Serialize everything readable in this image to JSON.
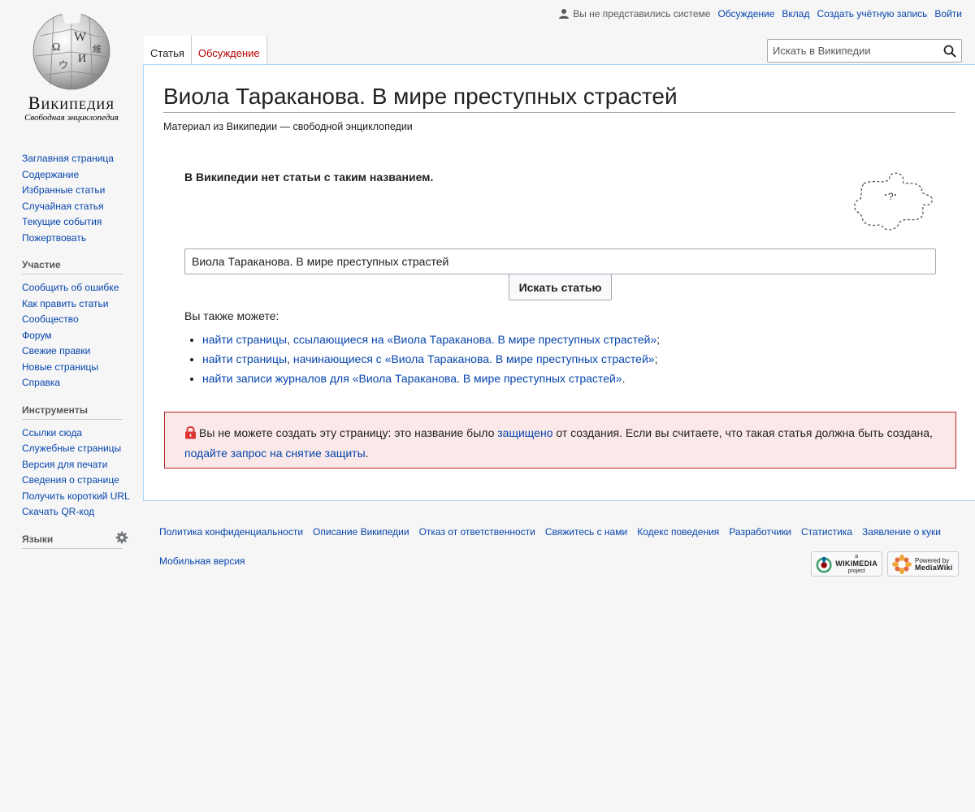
{
  "personal": {
    "anon_text": "Вы не представились системе",
    "links": [
      "Обсуждение",
      "Вклад",
      "Создать учётную запись",
      "Войти"
    ]
  },
  "logo": {
    "wordmark": "Википедия",
    "tagline": "Свободная энциклопедия"
  },
  "tabs": [
    {
      "label": "Статья",
      "selected": true
    },
    {
      "label": "Обсуждение",
      "selected": false
    }
  ],
  "search": {
    "placeholder": "Искать в Википедии"
  },
  "sidebar": {
    "nav": [
      "Заглавная страница",
      "Содержание",
      "Избранные статьи",
      "Случайная статья",
      "Текущие события",
      "Пожертвовать"
    ],
    "participate": {
      "heading": "Участие",
      "items": [
        "Сообщить об ошибке",
        "Как править статьи",
        "Сообщество",
        "Форум",
        "Свежие правки",
        "Новые страницы",
        "Справка"
      ]
    },
    "tools": {
      "heading": "Инструменты",
      "items": [
        "Ссылки сюда",
        "Служебные страницы",
        "Версия для печати",
        "Сведения о странице",
        "Получить короткий URL",
        "Скачать QR-код"
      ]
    },
    "languages": {
      "heading": "Языки"
    }
  },
  "content": {
    "title": "Виола Тараканова. В мире преступных страстей",
    "site_sub": "Материал из Википедии — свободной энциклопедии",
    "no_article": "В Википедии нет статьи с таким названием.",
    "search_value": "Виола Тараканова. В мире преступных страстей",
    "search_button": "Искать статью",
    "also_can": "Вы также можете:",
    "also_list": [
      {
        "link1": "найти страницы",
        "sep": ", ",
        "link2": "ссылающиеся на «Виола Тараканова. В мире преступных страстей»",
        "end": ";"
      },
      {
        "link1": "найти страницы",
        "sep": ", ",
        "link2": "начинающиеся с «Виола Тараканова. В мире преступных страстей»",
        "end": ";"
      },
      {
        "link1": "найти записи журналов для «Виола Тараканова",
        "sep": ". ",
        "link2": "В мире преступных страстей»",
        "end": "."
      }
    ],
    "protect": {
      "text1": "Вы не можете создать эту страницу: это название было ",
      "link1": "защищено",
      "text2": " от создания. Если вы считаете, что такая статья должна быть создана, ",
      "link2": "подайте запрос на снятие защиты",
      "text3": "."
    }
  },
  "footer": {
    "links": [
      "Политика конфиденциальности",
      "Описание Википедии",
      "Отказ от ответственности",
      "Свяжитесь с нами",
      "Кодекс поведения",
      "Разработчики",
      "Статистика",
      "Заявление о куки"
    ],
    "mobile": "Мобильная версия",
    "wikimedia_badge": {
      "top": "a",
      "main": "WIKIMEDIA",
      "bottom": "project"
    },
    "mediawiki_badge": {
      "top": "Powered by",
      "main": "MediaWiki"
    }
  },
  "colors": {
    "link": "#0645ad",
    "talk_tab": "#ba0000",
    "protect_bg": "#fbe9e9",
    "protect_border": "#b32424"
  }
}
